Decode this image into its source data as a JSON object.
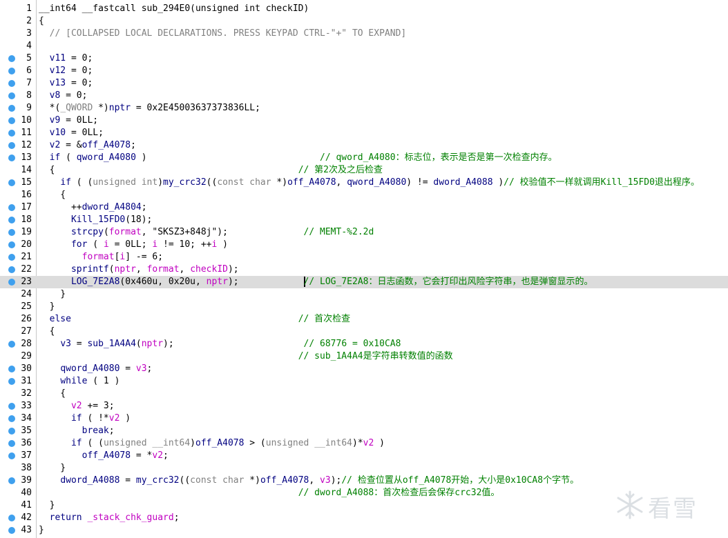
{
  "editor": {
    "highlighted_line": 23,
    "lines": [
      {
        "n": "1",
        "bp": false,
        "html": "<span class=\"d\">__int64 __fastcall sub_294E0(unsigned int checkID)</span>"
      },
      {
        "n": "2",
        "bp": false,
        "html": "<span class=\"d\">{</span>"
      },
      {
        "n": "3",
        "bp": false,
        "html": "  <span class=\"gr\">// [COLLAPSED LOCAL DECLARATIONS. PRESS KEYPAD CTRL-\"+\" TO EXPAND]</span>"
      },
      {
        "n": "4",
        "bp": false,
        "html": ""
      },
      {
        "n": "5",
        "bp": true,
        "html": "  <span class=\"v\">v11</span> = 0;"
      },
      {
        "n": "6",
        "bp": true,
        "html": "  <span class=\"v\">v12</span> = 0;"
      },
      {
        "n": "7",
        "bp": true,
        "html": "  <span class=\"v\">v13</span> = 0;"
      },
      {
        "n": "8",
        "bp": true,
        "html": "  <span class=\"v\">v8</span> = 0;"
      },
      {
        "n": "9",
        "bp": true,
        "html": "  *(<span class=\"gr\">_QWORD</span> *)<span class=\"v\">nptr</span> = 0x2E45003637373836LL;"
      },
      {
        "n": "10",
        "bp": true,
        "html": "  <span class=\"v\">v9</span> = 0LL;"
      },
      {
        "n": "11",
        "bp": true,
        "html": "  <span class=\"v\">v10</span> = 0LL;"
      },
      {
        "n": "12",
        "bp": true,
        "html": "  <span class=\"v\">v2</span> = &amp;<span class=\"v\">off_A4078</span>;"
      },
      {
        "n": "13",
        "bp": true,
        "html": "  <span class=\"v\">if</span> ( <span class=\"v\">qword_A4080</span> )                                <span class=\"g\">// qword_A4080：标志位，表示是否是第一次检查内存。</span>"
      },
      {
        "n": "14",
        "bp": false,
        "html": "  {                                             <span class=\"g\">// 第2次及之后检查</span>"
      },
      {
        "n": "15",
        "bp": true,
        "html": "    <span class=\"v\">if</span> ( (<span class=\"gr\">unsigned int</span>)<span class=\"v\">my_crc32</span>((<span class=\"gr\">const char</span> *)<span class=\"v\">off_A4078</span>, <span class=\"v\">qword_A4080</span>) != <span class=\"v\">dword_A4088</span> )<span class=\"g\">// 校验值不一样就调用Kill_15FD0退出程序。</span>"
      },
      {
        "n": "16",
        "bp": false,
        "html": "    {"
      },
      {
        "n": "17",
        "bp": true,
        "html": "      ++<span class=\"v\">dword_A4804</span>;"
      },
      {
        "n": "18",
        "bp": true,
        "html": "      <span class=\"v\">Kill_15FD0</span>(18);"
      },
      {
        "n": "19",
        "bp": true,
        "html": "      <span class=\"v\">strcpy</span>(<span class=\"pk\">format</span>, \"SKSZ3+848j\");              <span class=\"g\">// MEMT-%2.2d</span>"
      },
      {
        "n": "20",
        "bp": true,
        "html": "      <span class=\"v\">for</span> ( <span class=\"pk\">i</span> = 0LL; <span class=\"pk\">i</span> != 10; ++<span class=\"pk\">i</span> )"
      },
      {
        "n": "21",
        "bp": true,
        "html": "        <span class=\"pk\">format</span>[<span class=\"pk\">i</span>] -= 6;"
      },
      {
        "n": "22",
        "bp": true,
        "html": "      <span class=\"v\">sprintf</span>(<span class=\"pk\">nptr</span>, <span class=\"pk\">format</span>, <span class=\"pk\">checkID</span>);"
      },
      {
        "n": "23",
        "bp": true,
        "html": "      <span class=\"v\">LOG_7E2A8</span>(0x460u, 0x20u, <span class=\"pk\">nptr</span>);            <span class=\"cursor\"></span><span class=\"g\">// LOG_7E2A8：日志函数，它会打印出风险字符串，也是弹窗显示的。</span>"
      },
      {
        "n": "24",
        "bp": false,
        "html": "    }"
      },
      {
        "n": "25",
        "bp": false,
        "html": "  }"
      },
      {
        "n": "26",
        "bp": false,
        "html": "  <span class=\"v\">else</span>                                          <span class=\"g\">// 首次检查</span>"
      },
      {
        "n": "27",
        "bp": false,
        "html": "  {"
      },
      {
        "n": "28",
        "bp": true,
        "html": "    <span class=\"v\">v3</span> = <span class=\"v\">sub_1A4A4</span>(<span class=\"pk\">nptr</span>);                        <span class=\"g\">// 68776 = 0x10CA8</span>"
      },
      {
        "n": "29",
        "bp": false,
        "html": "                                                <span class=\"g\">// sub_1A4A4是字符串转数值的函数</span>"
      },
      {
        "n": "30",
        "bp": true,
        "html": "    <span class=\"v\">qword_A4080</span> = <span class=\"pk\">v3</span>;"
      },
      {
        "n": "31",
        "bp": true,
        "html": "    <span class=\"v\">while</span> ( 1 )"
      },
      {
        "n": "32",
        "bp": false,
        "html": "    {"
      },
      {
        "n": "33",
        "bp": true,
        "html": "      <span class=\"pk\">v2</span> += 3;"
      },
      {
        "n": "34",
        "bp": true,
        "html": "      <span class=\"v\">if</span> ( !*<span class=\"pk\">v2</span> )"
      },
      {
        "n": "35",
        "bp": true,
        "html": "        <span class=\"v\">break</span>;"
      },
      {
        "n": "36",
        "bp": true,
        "html": "      <span class=\"v\">if</span> ( (<span class=\"gr\">unsigned __int64</span>)<span class=\"v\">off_A4078</span> &gt; (<span class=\"gr\">unsigned __int64</span>)*<span class=\"pk\">v2</span> )"
      },
      {
        "n": "37",
        "bp": true,
        "html": "        <span class=\"v\">off_A4078</span> = *<span class=\"pk\">v2</span>;"
      },
      {
        "n": "38",
        "bp": false,
        "html": "    }"
      },
      {
        "n": "39",
        "bp": true,
        "html": "    <span class=\"v\">dword_A4088</span> = <span class=\"v\">my_crc32</span>((<span class=\"gr\">const char</span> *)<span class=\"v\">off_A4078</span>, <span class=\"pk\">v3</span>);<span class=\"g\">// 检查位置从off_A4078开始，大小是0x10CA8个字节。</span>"
      },
      {
        "n": "40",
        "bp": false,
        "html": "                                                <span class=\"g\">// dword_A4088：首次检查后会保存crc32值。</span>"
      },
      {
        "n": "41",
        "bp": false,
        "html": "  }"
      },
      {
        "n": "42",
        "bp": true,
        "html": "  <span class=\"v\">return</span> <span class=\"pk\">_stack_chk_guard</span>;"
      },
      {
        "n": "43",
        "bp": true,
        "html": "}"
      }
    ]
  },
  "watermark": {
    "text": "看雪"
  }
}
